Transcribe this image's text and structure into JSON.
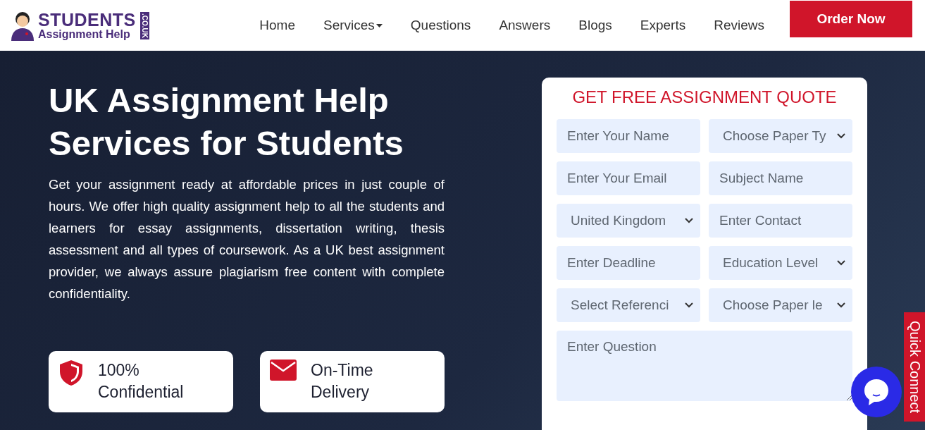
{
  "logo": {
    "word": "STUDENTS",
    "tagline": "Assignment Help",
    "domain": ".CO.UK"
  },
  "nav": [
    {
      "label": "Home",
      "dropdown": false
    },
    {
      "label": "Services",
      "dropdown": true
    },
    {
      "label": "Questions",
      "dropdown": false
    },
    {
      "label": "Answers",
      "dropdown": false
    },
    {
      "label": "Blogs",
      "dropdown": false
    },
    {
      "label": "Experts",
      "dropdown": false
    },
    {
      "label": "Reviews",
      "dropdown": false
    }
  ],
  "order_button": "Order Now",
  "hero": {
    "title_lines": [
      "UK Assignment Help",
      "Services for Students"
    ],
    "description": "Get your assignment ready at affordable prices in just couple of hours. We offer high quality assignment help to all the students and learners for essay assignments, dissertation writing, thesis assessment and all types of coursework. As a UK best assignment provider, we always assure plagiarism free content with complete confidentiality.",
    "features": [
      {
        "lines": [
          "100%",
          "Confidential"
        ]
      },
      {
        "lines": [
          "On-Time",
          "Delivery"
        ]
      }
    ]
  },
  "quote_form": {
    "title": "GET FREE ASSIGNMENT QUOTE",
    "fields": [
      {
        "kind": "input",
        "placeholder": "Enter Your Name"
      },
      {
        "kind": "select",
        "value": "Choose Paper Ty"
      },
      {
        "kind": "input",
        "placeholder": "Enter Your Email"
      },
      {
        "kind": "input",
        "placeholder": "Subject Name"
      },
      {
        "kind": "select",
        "value": "United Kingdom"
      },
      {
        "kind": "input",
        "placeholder": "Enter Contact"
      },
      {
        "kind": "input",
        "placeholder": "Enter Deadline"
      },
      {
        "kind": "select",
        "value": "Education Level"
      },
      {
        "kind": "select",
        "value": "Select Referenci"
      },
      {
        "kind": "select",
        "value": "Choose Paper le"
      },
      {
        "kind": "textarea",
        "placeholder": "Enter Question"
      }
    ]
  },
  "quick_connect": "Quick Connect"
}
